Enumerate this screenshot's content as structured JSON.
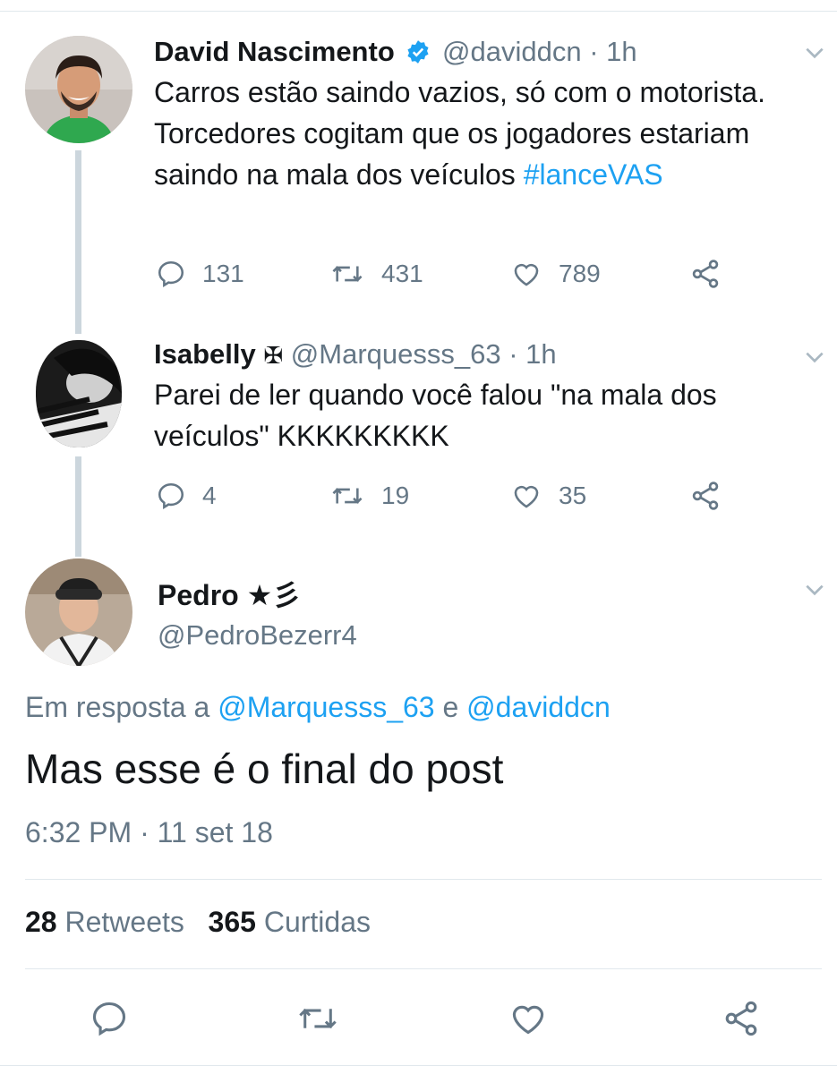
{
  "thread": [
    {
      "name": "David Nascimento",
      "verified": true,
      "handle": "@daviddcn",
      "time": "· 1h",
      "text": "Carros estão saindo vazios, só com o motorista. Torcedores cogitam que os jogadores estariam saindo na mala dos veículos ",
      "hashtag": "#lanceVAS",
      "replies": "131",
      "retweets": "431",
      "likes": "789"
    },
    {
      "name": "Isabelly",
      "name_symbol": "✠",
      "handle": "@Marquesss_63",
      "time": "· 1h",
      "text": "Parei de ler quando você falou \"na mala dos veículos\" KKKKKKKKK",
      "replies": "4",
      "retweets": "19",
      "likes": "35"
    }
  ],
  "focused": {
    "name": "Pedro ★彡",
    "handle": "@PedroBezerr4",
    "reply_prefix": "Em resposta a ",
    "reply_mention_1": "@Marquesss_63",
    "reply_joiner": " e ",
    "reply_mention_2": "@daviddcn",
    "text": "Mas esse é o final do post",
    "timestamp": "6:32 PM · 11 set 18",
    "retweets_count": "28",
    "retweets_label": "Retweets",
    "likes_count": "365",
    "likes_label": "Curtidas"
  },
  "icons": {
    "reply": "reply-icon",
    "retweet": "retweet-icon",
    "like": "heart-icon",
    "share": "share-icon",
    "more": "chevron-down-icon",
    "verified": "verified-badge-icon"
  },
  "colors": {
    "link": "#1da1f2",
    "muted": "#657786",
    "text": "#14171a",
    "thread_line": "#ccd6dd"
  }
}
